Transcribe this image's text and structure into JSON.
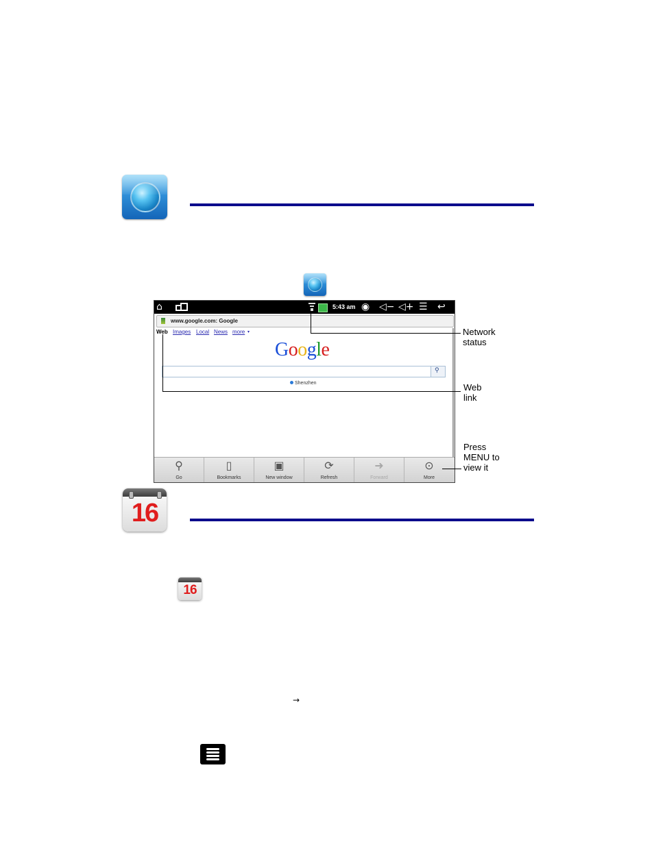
{
  "browser_section": {
    "icon": "browser-globe-icon"
  },
  "screenshot": {
    "status_bar": {
      "time": "5:43 am",
      "icons": [
        "home-icon",
        "recent-apps-icon",
        "wifi-icon",
        "battery-icon",
        "eye-icon",
        "volume-down-icon",
        "volume-up-icon",
        "menu-icon",
        "back-icon"
      ]
    },
    "url_bar": {
      "text": "www.google.com: Google"
    },
    "nav_links": {
      "web": "Web",
      "images": "Images",
      "local": "Local",
      "news": "News",
      "more": "more"
    },
    "google_logo": {
      "letters": [
        "G",
        "o",
        "o",
        "g",
        "l",
        "e"
      ],
      "colors": [
        "#1a4fd8",
        "#d61e1e",
        "#e8b418",
        "#1a4fd8",
        "#1d9a2e",
        "#d61e1e"
      ]
    },
    "location": "Shenzhen",
    "menu": {
      "go": "Go",
      "bookmarks": "Bookmarks",
      "new_window": "New window",
      "refresh": "Refresh",
      "forward": "Forward",
      "more": "More"
    }
  },
  "callouts": {
    "network_line1": "Network",
    "network_line2": "status",
    "weblink_line1": "Web",
    "weblink_line2": "link",
    "press_line1": "Press",
    "press_line2": "MENU to",
    "press_line3": "view it"
  },
  "calendar_section": {
    "icon_number": "16",
    "small_icon_number": "16"
  },
  "arrow_glyph": "→",
  "colors": {
    "rule": "#0b0b8c",
    "link": "#2a2ab0"
  }
}
